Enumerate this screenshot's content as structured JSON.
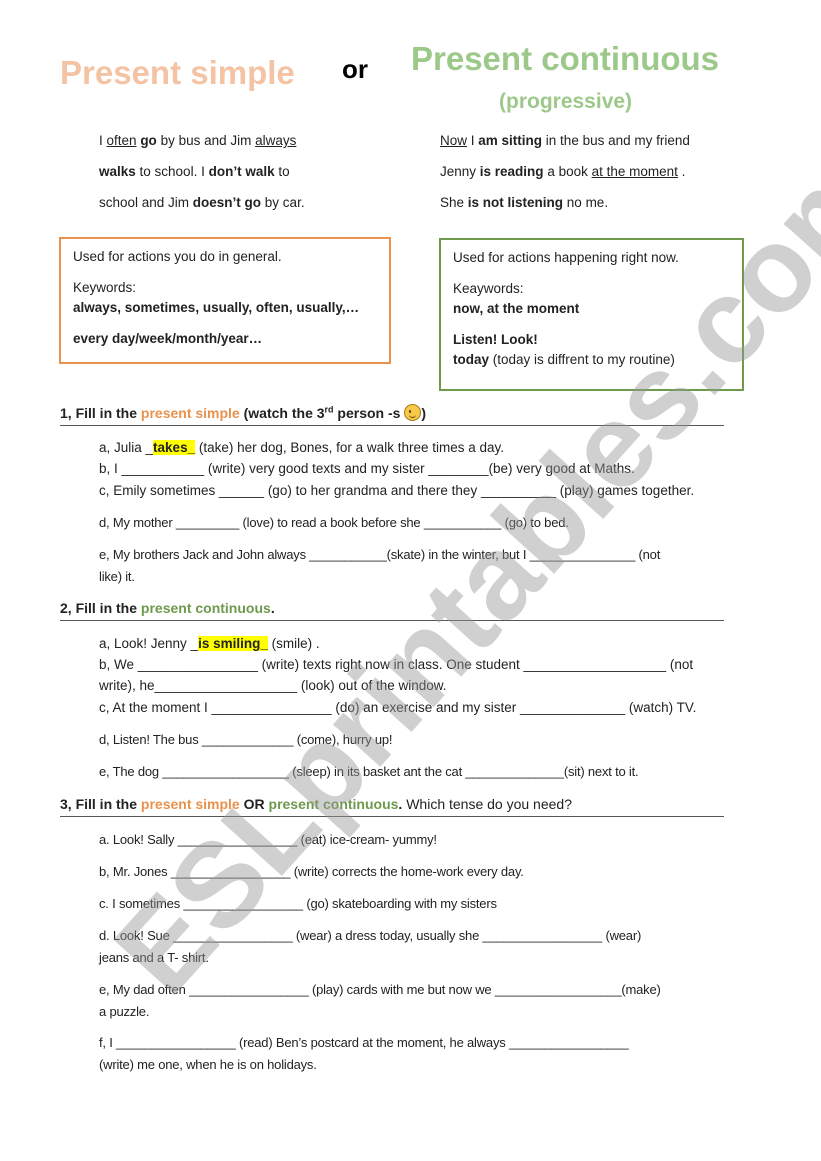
{
  "header": {
    "title_simple": "Present simple",
    "or": "or",
    "title_continuous": "Present continuous",
    "subtitle_continuous": "(progressive)"
  },
  "examples": {
    "simple": [
      [
        "I ",
        "often",
        " ",
        "go",
        " by bus and Jim ",
        "always "
      ],
      [
        "walks",
        " to school. I ",
        "don’t walk",
        " to"
      ],
      [
        "school and Jim  ",
        "doesn’t go",
        " by car."
      ]
    ],
    "continuous": [
      [
        "Now",
        " I ",
        "am sitting",
        " in the bus and my friend"
      ],
      [
        "Jenny ",
        "is reading",
        " a book ",
        "at the moment",
        " ."
      ],
      [
        "She ",
        "is not listening",
        " no me."
      ]
    ]
  },
  "boxes": {
    "simple": {
      "usage": "Used for actions you do in general.",
      "keywords_label": "Keywords:",
      "keywords": "always, sometimes, usually, often, usually,…",
      "keywords2": "every day/week/month/year…"
    },
    "continuous": {
      "usage": "Used for actions happening right now.",
      "keywords_label": "Keaywords:",
      "keywords": "now, at the moment",
      "keywords2": "Listen! Look!",
      "keywords3_bold": "today",
      "keywords3_rest": " (today is diffrent to my routine)"
    }
  },
  "section1": {
    "prefix": "1, Fill in the ",
    "tense": "present simple",
    "suffix": " (watch the 3",
    "sup": "rd",
    "suffix2": " person -s ",
    "end": ")",
    "items": {
      "a_pre": "a, Julia _",
      "a_ans": "takes_",
      "a_post": " (take) her dog, Bones, for a walk three times a day.",
      "b": "b, I ___________ (write) very good texts and my sister ________(be) very good at Maths.",
      "c": "c, Emily sometimes ______ (go) to her grandma and there they __________ (play) games together.",
      "d": "d, My mother _________ (love) to read a book before she ___________ (go) to bed.",
      "e1": "e, My brothers Jack and John always ___________(skate) in the winter, but I _______________ (not",
      "e2": "like) it."
    }
  },
  "section2": {
    "prefix": "2, Fill in the ",
    "tense": "present continuous",
    "end": ".",
    "items": {
      "a_pre": "a, Look! Jenny _",
      "a_ans": "is smiling_",
      "a_post": " (smile) .",
      "b1": "b, We ________________ (write) texts right now in class. One student ___________________ (not",
      "b2": "write), he___________________ (look)  out of the window.",
      "c": "c, At the moment I   ________________ (do) an exercise and my sister  ______________ (watch) TV.",
      "d": "d, Listen! The bus _____________ (come), hurry up!",
      "e": "e, The dog __________________ (sleep) in its basket ant the cat ______________(sit) next to it."
    }
  },
  "section3": {
    "prefix": "3, Fill in the ",
    "tense1": "present simple",
    "or": " OR ",
    "tense2": "present continuous",
    "dot": ".",
    "rest": " Which tense do you need?",
    "items": {
      "a": "a. Look! Sally _________________ (eat) ice-cream- yummy!",
      "b": "b, Mr. Jones  _________________ (write) corrects the home-work every day.",
      "c": "c. I sometimes  _________________ (go) skateboarding with my sisters",
      "d1": "d. Look! Sue  _________________ (wear) a dress today, usually she  _________________  (wear)",
      "d2": "jeans and a T- shirt.",
      "e1": "e, My dad often  _________________ (play) cards with me but now we __________________(make)",
      "e2": "a puzzle.",
      "f1": "f, I  _________________ (read) Ben’s postcard at the moment, he always _________________",
      "f2": "(write) me one, when he is on holidays."
    }
  },
  "watermark": "ESLprintables.com",
  "colors": {
    "simple_title": "#f4c3a4",
    "continuous_title": "#9cc98a",
    "simple_accent": "#e8924e",
    "continuous_accent": "#6e9a4d",
    "highlight": "#ffff00"
  }
}
